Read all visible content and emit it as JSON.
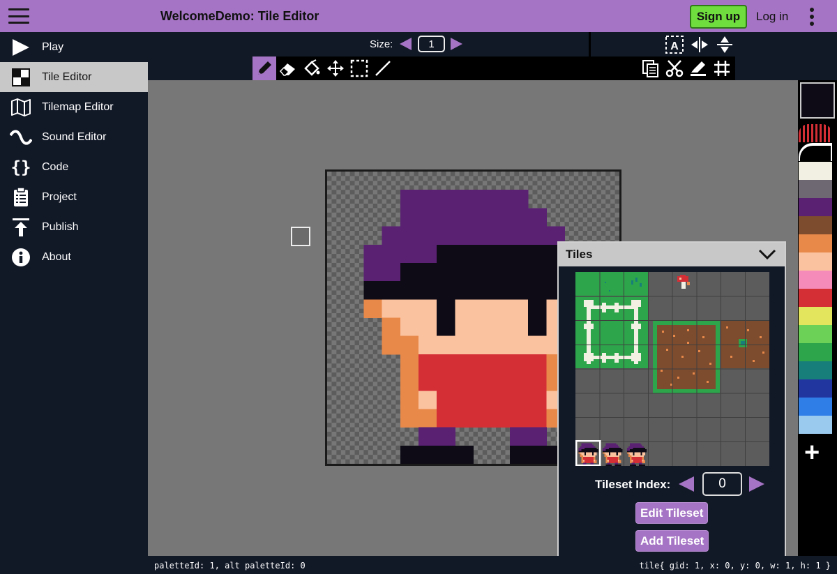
{
  "header": {
    "title": "WelcomeDemo: Tile Editor",
    "signup_label": "Sign up",
    "login_label": "Log in"
  },
  "sidebar": {
    "items": [
      {
        "label": "Play",
        "icon": "play-icon"
      },
      {
        "label": "Tile Editor",
        "icon": "tile-editor-icon",
        "active": true
      },
      {
        "label": "Tilemap Editor",
        "icon": "map-icon"
      },
      {
        "label": "Sound Editor",
        "icon": "sound-wave-icon"
      },
      {
        "label": "Code",
        "icon": "curly-braces-icon"
      },
      {
        "label": "Project",
        "icon": "clipboard-icon"
      },
      {
        "label": "Publish",
        "icon": "upload-icon"
      },
      {
        "label": "About",
        "icon": "info-icon"
      }
    ]
  },
  "toolbar": {
    "size_label": "Size:",
    "size_value": "1",
    "tools": [
      "pencil-icon",
      "eraser-icon",
      "fill-bucket-icon",
      "move-icon",
      "select-icon",
      "line-icon"
    ],
    "active_tool": "pencil-icon",
    "right_tools_top": [
      "text-select-icon",
      "flip-horizontal-icon",
      "flip-vertical-icon"
    ],
    "right_tools_bottom": [
      "copy-icon",
      "cut-icon",
      "paste-icon",
      "grid-icon"
    ]
  },
  "tiles_panel": {
    "title": "Tiles",
    "tileset_index_label": "Tileset Index:",
    "tileset_index_value": "0",
    "edit_button": "Edit Tileset",
    "add_button": "Add Tileset"
  },
  "palette": {
    "colors": [
      "#f1f0e2",
      "#6e6873",
      "#5a2173",
      "#7d4b2d",
      "#e8894a",
      "#fbc29f",
      "#f58bb8",
      "#d52f36",
      "#e3e55c",
      "#6cd157",
      "#2da54b",
      "#177e7a",
      "#2236a0",
      "#2f7ee8",
      "#9bcaef"
    ]
  },
  "status": {
    "left": "paletteId: 1, alt paletteId: 0",
    "right": "tile{ gid: 1, x: 0, y: 0, w: 1, h: 1 }"
  }
}
